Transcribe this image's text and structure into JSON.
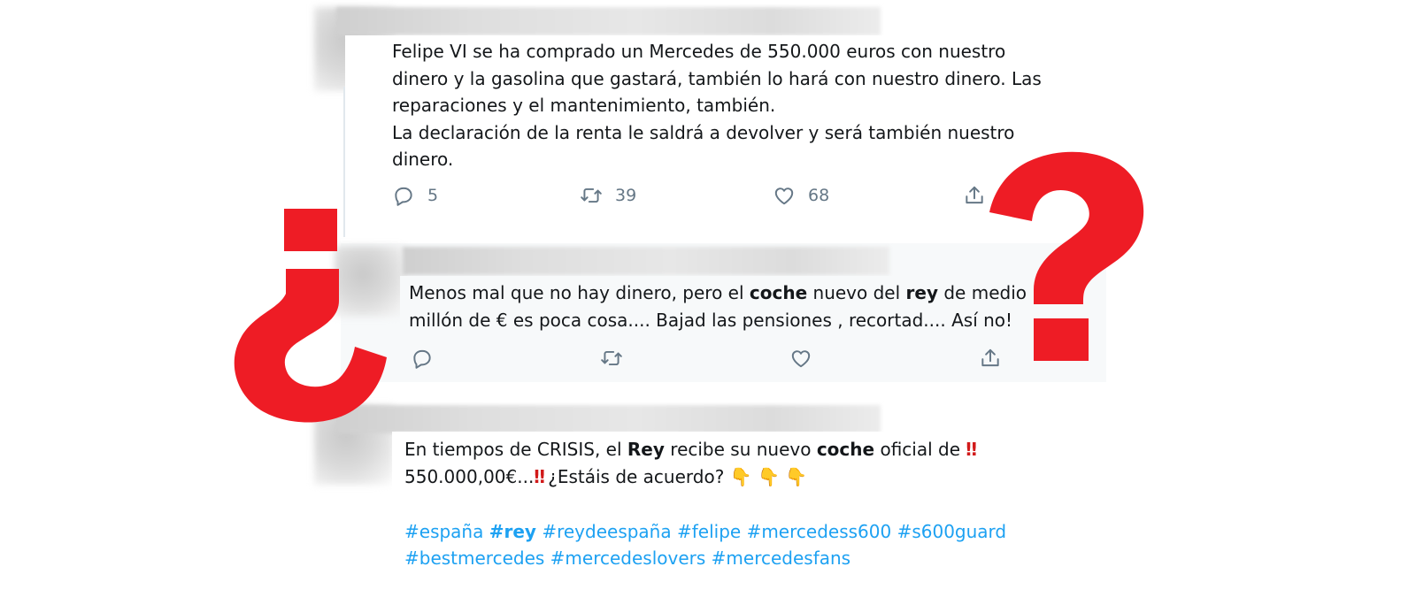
{
  "tweet1": {
    "text": "Felipe VI se ha comprado un Mercedes de 550.000 euros con nuestro\ndinero y la gasolina que gastará, también lo hará con nuestro dinero. Las\nreparaciones y el mantenimiento, también.\nLa declaración de la renta le saldrá a devolver y será también nuestro\ndinero.",
    "reply_count": "5",
    "retweet_count": "39",
    "like_count": "68"
  },
  "tweet2": {
    "text_part1": "Menos mal que no hay dinero, pero el ",
    "bold1": "coche",
    "text_part2": " nuevo del ",
    "bold2": "rey",
    "text_part3": " de medio",
    "line2": "millón de € es poca cosa.... Bajad las pensiones , recortad.... Así no!"
  },
  "tweet3": {
    "text_part1": "En tiempos de CRISIS, el ",
    "bold1": "Rey",
    "text_part2": " recibe su nuevo ",
    "bold2": "coche",
    "text_part3": " oficial de ",
    "emoji_bangbang": "‼",
    "line2_part1": "550.000,00€...",
    "line2_part2": " ¿Estáis de acuerdo? ",
    "emoji_point": "👇",
    "hashtags_line1": [
      "#españa",
      "#rey",
      "#reydeespaña",
      "#felipe",
      "#mercedess600",
      "#s600guard"
    ],
    "hashtags_line2": [
      "#bestmercedes",
      "#mercedeslovers",
      "#mercedesfans"
    ]
  },
  "overlay": {
    "inverted_question_mark": "¿",
    "question_mark": "?",
    "color": "#ee1c25"
  },
  "colors": {
    "link": "#1da1f2",
    "icon_gray": "#657786"
  }
}
